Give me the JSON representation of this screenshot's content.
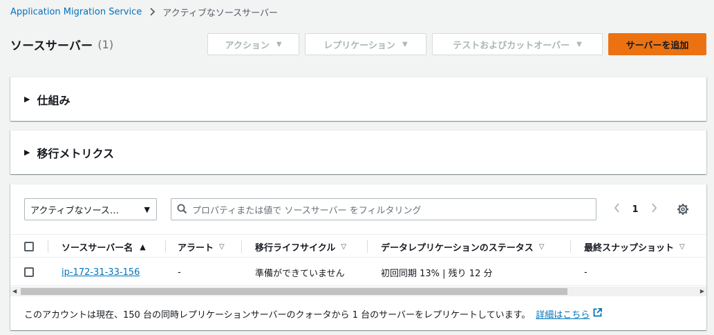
{
  "breadcrumb": {
    "root": "Application Migration Service",
    "current": "アクティブなソースサーバー"
  },
  "header": {
    "title": "ソースサーバー",
    "count": "(1)",
    "actions": {
      "action_label": "アクション",
      "replication_label": "レプリケーション",
      "test_cutover_label": "テストおよびカットオーバー",
      "add_server_label": "サーバーを追加"
    }
  },
  "sections": {
    "how_it_works": "仕組み",
    "migration_metrics": "移行メトリクス"
  },
  "filter": {
    "select_value": "アクティブなソース…",
    "search_placeholder": "プロパティまたは値で ソースサーバー をフィルタリング"
  },
  "pagination": {
    "current_page": "1"
  },
  "table": {
    "columns": {
      "name": "ソースサーバー名",
      "alerts": "アラート",
      "lifecycle": "移行ライフサイクル",
      "replication_status": "データレプリケーションのステータス",
      "last_snapshot": "最終スナップショット"
    },
    "rows": [
      {
        "name": "ip-172-31-33-156",
        "alerts": "-",
        "lifecycle": "準備ができていません",
        "replication_status": "初回同期 13% | 残り 12 分",
        "last_snapshot": "-"
      }
    ]
  },
  "footer": {
    "note": "このアカウントは現在、150 台の同時レプリケーションサーバーのクォータから 1 台のサーバーをレプリケートしています。",
    "link": "詳細はこちら"
  },
  "colors": {
    "primary_button": "#ec7211",
    "link": "#0073bb",
    "disabled_text": "#aab7b8"
  }
}
